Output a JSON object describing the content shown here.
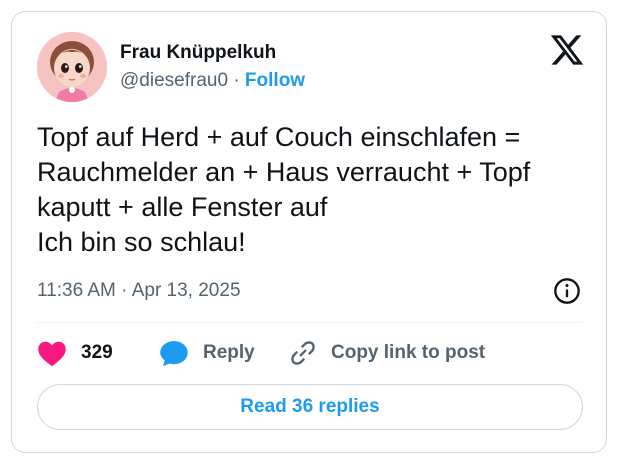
{
  "author": {
    "name": "Frau Knüppelkuh",
    "handle": "@diesefrau0",
    "separator": "·",
    "follow_label": "Follow"
  },
  "tweet": {
    "text": "Topf auf Herd + auf Couch einschlafen =\nRauchmelder an + Haus verraucht + Topf\nkaputt + alle Fenster auf\nIch bin so schlau!",
    "timestamp": "11:36 AM · Apr 13, 2025"
  },
  "actions": {
    "likes_count": "329",
    "reply_label": "Reply",
    "copy_link_label": "Copy link to post"
  },
  "read_replies_label": "Read 36 replies",
  "icons": {
    "brand": "x-logo-icon",
    "info": "info-icon",
    "like": "heart-icon",
    "reply": "speech-bubble-icon",
    "copy": "link-icon"
  },
  "colors": {
    "accent": "#1d9bf0",
    "like": "#f91880",
    "text": "#0f1419",
    "secondary": "#536471",
    "border": "#cfd9de"
  }
}
